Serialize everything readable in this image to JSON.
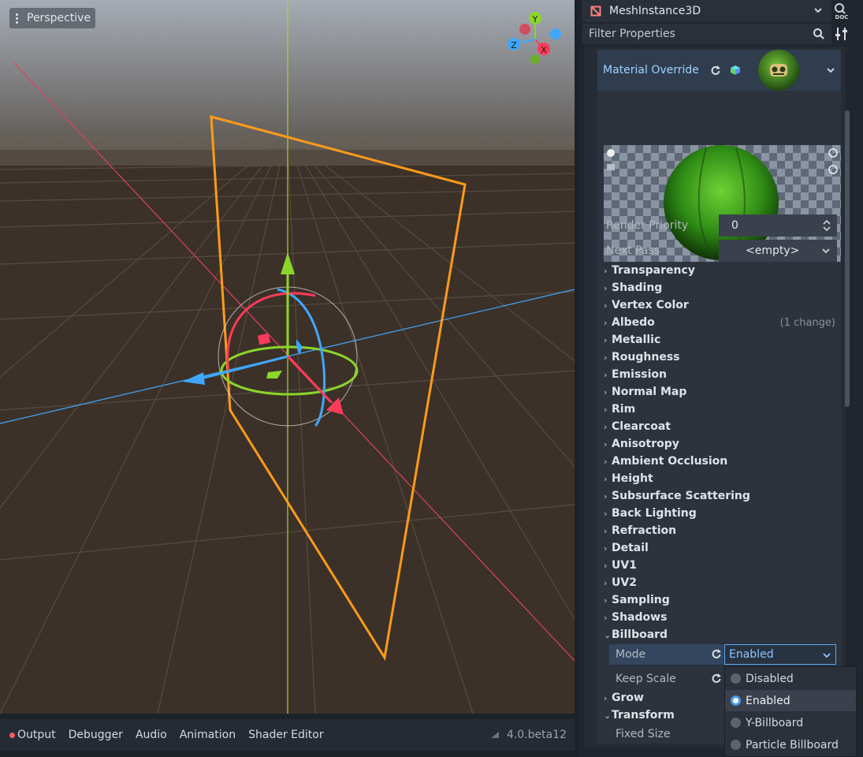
{
  "viewport": {
    "perspective_label": "Perspective",
    "gizmo_axes": [
      "Y",
      "X",
      "Z"
    ]
  },
  "bottom_bar": {
    "tabs": [
      "Output",
      "Debugger",
      "Audio",
      "Animation",
      "Shader Editor"
    ],
    "version": "4.0.beta12"
  },
  "inspector": {
    "node_name": "MeshInstance3D",
    "filter_placeholder": "Filter Properties",
    "material_override_label": "Material Override",
    "render_priority": {
      "label": "Render Priority",
      "value": "0"
    },
    "next_pass": {
      "label": "Next Pass",
      "value": "<empty>"
    },
    "sections": [
      {
        "label": "Transparency",
        "expanded": false
      },
      {
        "label": "Shading",
        "expanded": false
      },
      {
        "label": "Vertex Color",
        "expanded": false
      },
      {
        "label": "Albedo",
        "expanded": false,
        "note": "(1 change)"
      },
      {
        "label": "Metallic",
        "expanded": false
      },
      {
        "label": "Roughness",
        "expanded": false
      },
      {
        "label": "Emission",
        "expanded": false
      },
      {
        "label": "Normal Map",
        "expanded": false
      },
      {
        "label": "Rim",
        "expanded": false
      },
      {
        "label": "Clearcoat",
        "expanded": false
      },
      {
        "label": "Anisotropy",
        "expanded": false
      },
      {
        "label": "Ambient Occlusion",
        "expanded": false
      },
      {
        "label": "Height",
        "expanded": false
      },
      {
        "label": "Subsurface Scattering",
        "expanded": false
      },
      {
        "label": "Back Lighting",
        "expanded": false
      },
      {
        "label": "Refraction",
        "expanded": false
      },
      {
        "label": "Detail",
        "expanded": false
      },
      {
        "label": "UV1",
        "expanded": false
      },
      {
        "label": "UV2",
        "expanded": false
      },
      {
        "label": "Sampling",
        "expanded": false
      },
      {
        "label": "Shadows",
        "expanded": false
      },
      {
        "label": "Billboard",
        "expanded": true
      }
    ],
    "billboard": {
      "mode_label": "Mode",
      "mode_value": "Enabled",
      "keep_scale_label": "Keep Scale"
    },
    "after_sections": [
      {
        "label": "Grow",
        "expanded": false
      },
      {
        "label": "Transform",
        "expanded": true
      }
    ],
    "fixed_size_label": "Fixed Size",
    "mode_options": [
      {
        "label": "Disabled",
        "selected": false
      },
      {
        "label": "Enabled",
        "selected": true
      },
      {
        "label": "Y-Billboard",
        "selected": false
      },
      {
        "label": "Particle Billboard",
        "selected": false
      }
    ]
  },
  "colors": {
    "accent": "#5aa9f0",
    "selection_outline": "#ff9b1a",
    "axis_x": "#ff3b5a",
    "axis_y": "#8ad62a",
    "axis_z": "#3fa7ff"
  }
}
